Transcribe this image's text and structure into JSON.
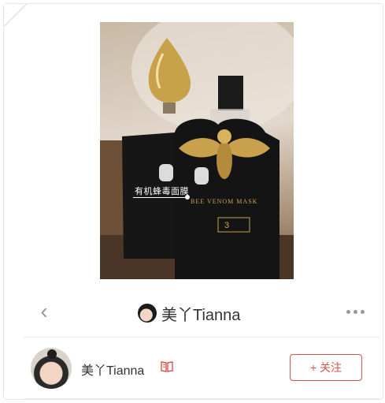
{
  "image": {
    "product_tag": "有机蜂毒面膜",
    "mask_brand_text": "BEE VENOM MASK"
  },
  "nav": {
    "title": "美丫Tianna"
  },
  "author": {
    "name": "美丫Tianna",
    "follow_label": "+ 关注"
  },
  "colors": {
    "accent": "#d9534f",
    "muted": "#999999",
    "text": "#333333"
  },
  "icons": [
    "back-arrow-icon",
    "more-dots-icon",
    "book-icon"
  ]
}
